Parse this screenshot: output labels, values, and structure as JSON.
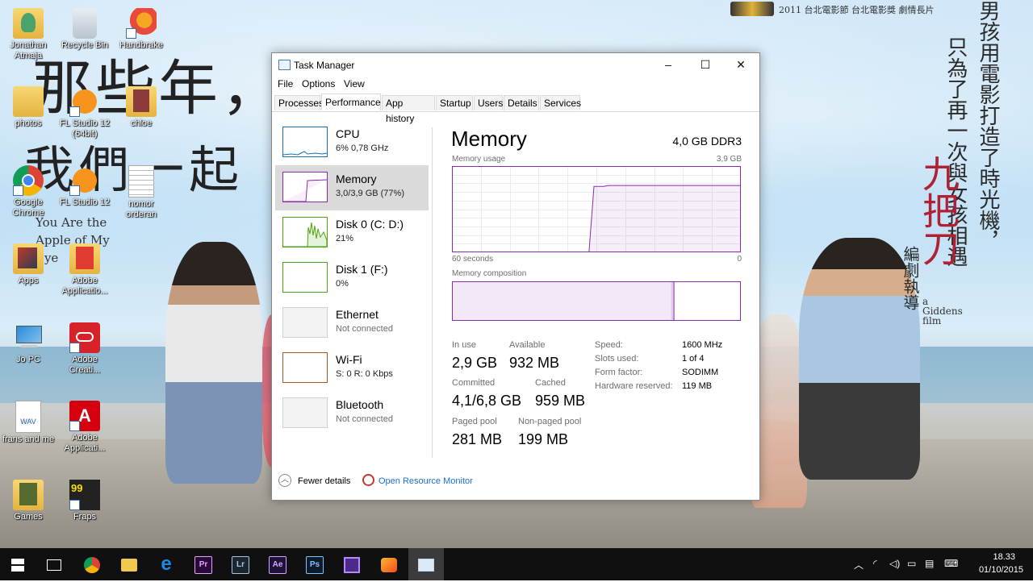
{
  "desktop": {
    "wallpaper_text": {
      "handwritten_1": "那些年，",
      "handwritten_2": "我們一起",
      "english": "You Are the Apple of My Eye",
      "vertical_1": "男孩用電影打造了時光機，",
      "vertical_2": "只為了再一次與女孩相遇",
      "title_red": "九把刀",
      "credit": "編劇執導",
      "sub": "a Giddens film",
      "award": "2011 台北電影節 台北電影獎 劇情長片"
    },
    "icons": [
      {
        "label": "Jonathan Atmaja",
        "icon": "user-folder-icon"
      },
      {
        "label": "Recycle Bin",
        "icon": "recycle-bin-icon"
      },
      {
        "label": "Handbrake",
        "icon": "handbrake-icon"
      },
      {
        "label": "photos",
        "icon": "folder-icon"
      },
      {
        "label": "FL Studio 12 (64bit)",
        "icon": "fl-studio-icon"
      },
      {
        "label": "chloe",
        "icon": "folder-icon"
      },
      {
        "label": "Google Chrome",
        "icon": "chrome-icon"
      },
      {
        "label": "FL Studio 12",
        "icon": "fl-studio-icon"
      },
      {
        "label": "nomor orderan",
        "icon": "text-file-icon"
      },
      {
        "label": "Apps",
        "icon": "folder-icon"
      },
      {
        "label": "Adobe Applicatio...",
        "icon": "folder-icon"
      },
      {
        "label": "Jo PC",
        "icon": "computer-icon"
      },
      {
        "label": "Adobe Creati...",
        "icon": "creative-cloud-icon"
      },
      {
        "label": "frans and me",
        "icon": "wav-file-icon"
      },
      {
        "label": "Adobe Applicati...",
        "icon": "adobe-icon"
      },
      {
        "label": "Games",
        "icon": "folder-icon"
      },
      {
        "label": "Fraps",
        "icon": "fraps-icon"
      }
    ]
  },
  "task_manager": {
    "title": "Task Manager",
    "window_buttons": {
      "minimize": "–",
      "maximize": "☐",
      "close": "✕"
    },
    "menu": [
      "File",
      "Options",
      "View"
    ],
    "tabs": [
      "Processes",
      "Performance",
      "App history",
      "Startup",
      "Users",
      "Details",
      "Services"
    ],
    "active_tab": "Performance",
    "side_items": [
      {
        "name": "CPU",
        "value": "6% 0,78 GHz",
        "color": "#1170b8"
      },
      {
        "name": "Memory",
        "value": "3,0/3,9 GB (77%)",
        "color": "#8b2aab"
      },
      {
        "name": "Disk 0 (C: D:)",
        "value": "21%",
        "color": "#4da60c"
      },
      {
        "name": "Disk 1 (F:)",
        "value": "0%",
        "color": "#4da60c"
      },
      {
        "name": "Ethernet",
        "value": "Not connected",
        "color": "#bdbdbd"
      },
      {
        "name": "Wi-Fi",
        "value": "S: 0 R: 0 Kbps",
        "color": "#a7581d"
      },
      {
        "name": "Bluetooth",
        "value": "Not connected",
        "color": "#bdbdbd"
      }
    ],
    "selected_item": "Memory",
    "memory": {
      "heading": "Memory",
      "type": "4,0 GB DDR3",
      "usage_label": "Memory usage",
      "usage_max": "3,9 GB",
      "time_left": "60 seconds",
      "time_right": "0",
      "composition_label": "Memory composition",
      "usage_graph": {
        "points_percent": [
          0,
          0,
          0,
          0,
          0,
          0,
          0,
          0,
          0,
          0,
          0,
          0,
          0,
          0,
          0,
          0,
          0,
          0,
          0,
          0,
          0,
          0,
          0,
          0,
          0,
          0,
          0,
          0,
          0,
          77,
          77,
          77,
          78,
          78,
          78,
          78,
          78,
          78,
          78,
          78,
          78,
          78,
          78,
          78,
          78,
          78,
          78,
          78,
          78,
          78,
          78,
          78,
          78,
          78,
          78,
          78,
          78,
          78,
          78,
          78
        ]
      },
      "composition_graph": {
        "in_use_fraction": 0.76,
        "modified_fraction": 0.01
      },
      "stats": [
        {
          "label": "In use",
          "value": "2,9 GB"
        },
        {
          "label": "Available",
          "value": "932 MB"
        },
        {
          "label": "Committed",
          "value": "4,1/6,8 GB"
        },
        {
          "label": "Cached",
          "value": "959 MB"
        },
        {
          "label": "Paged pool",
          "value": "281 MB"
        },
        {
          "label": "Non-paged pool",
          "value": "199 MB"
        }
      ],
      "specs": [
        {
          "label": "Speed:",
          "value": "1600 MHz"
        },
        {
          "label": "Slots used:",
          "value": "1 of 4"
        },
        {
          "label": "Form factor:",
          "value": "SODIMM"
        },
        {
          "label": "Hardware reserved:",
          "value": "119 MB"
        }
      ]
    },
    "bottom": {
      "fewer_details": "Fewer details",
      "resource_monitor": "Open Resource Monitor"
    }
  },
  "taskbar": {
    "apps": [
      {
        "name": "start",
        "icon": "windows-logo-icon"
      },
      {
        "name": "task-view",
        "icon": "task-view-icon"
      },
      {
        "name": "chrome",
        "icon": "chrome-icon"
      },
      {
        "name": "file-explorer",
        "icon": "folder-icon"
      },
      {
        "name": "edge",
        "icon": "edge-icon",
        "glyph": "e"
      },
      {
        "name": "premiere",
        "icon": "premiere-icon",
        "glyph": "Pr"
      },
      {
        "name": "lightroom",
        "icon": "lightroom-icon",
        "glyph": "Lr"
      },
      {
        "name": "after-effects",
        "icon": "after-effects-icon",
        "glyph": "Ae"
      },
      {
        "name": "photoshop",
        "icon": "photoshop-icon",
        "glyph": "Ps"
      },
      {
        "name": "cpu-app",
        "icon": "chip-icon"
      },
      {
        "name": "media-player",
        "icon": "media-player-icon"
      },
      {
        "name": "task-manager",
        "icon": "task-manager-icon"
      }
    ],
    "clock_time": "18.33",
    "clock_date": "01/10/2015"
  }
}
